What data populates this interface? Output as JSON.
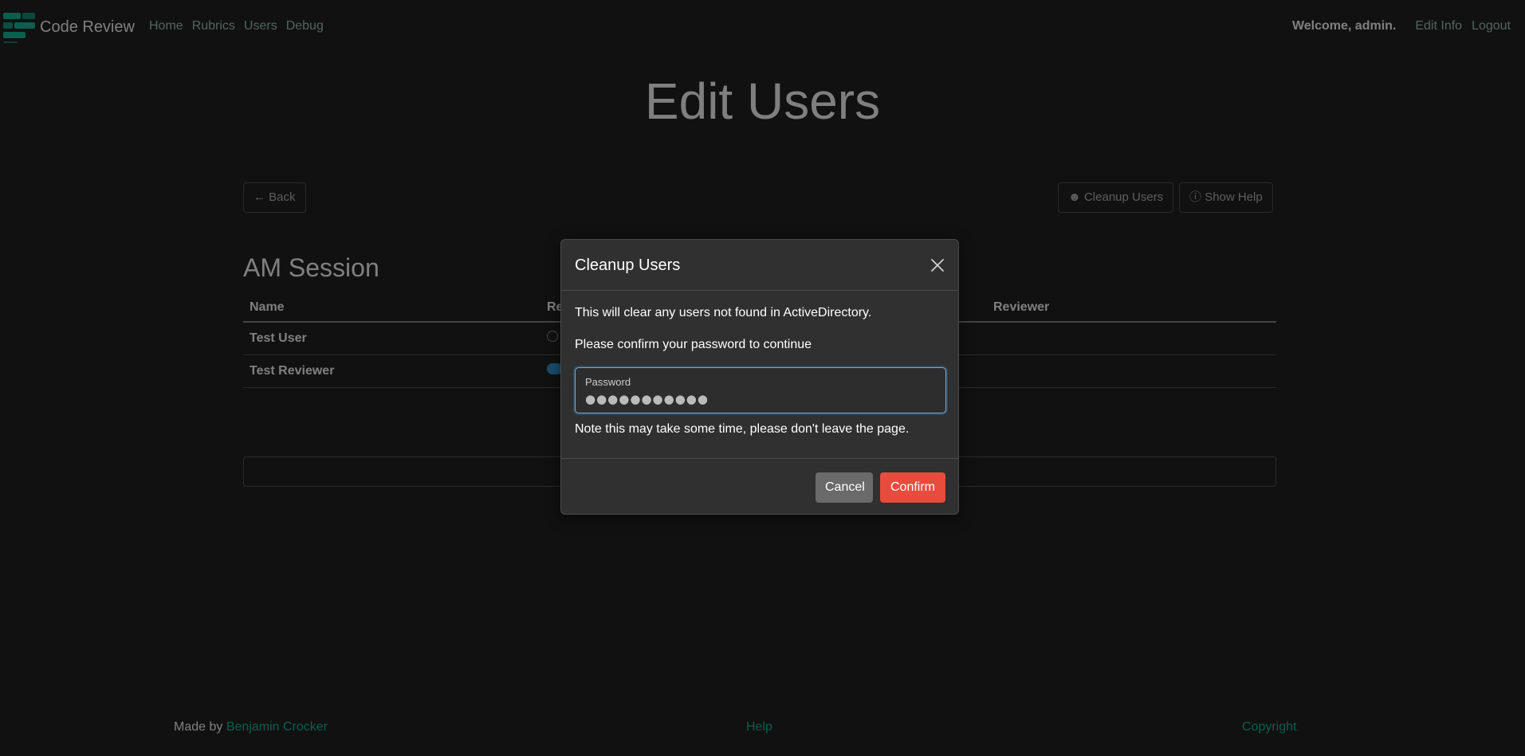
{
  "navbar": {
    "brand": "Code Review",
    "links": [
      "Home",
      "Rubrics",
      "Users",
      "Debug"
    ],
    "welcome": "Welcome, admin.",
    "edit_info": "Edit Info",
    "logout": "Logout"
  },
  "page": {
    "title": "Edit Users",
    "back_label": "← Back",
    "cleanup_label": "Cleanup Users",
    "help_label": "Show Help"
  },
  "session": {
    "title": "AM Session",
    "columns": [
      "Name",
      "Re",
      "Reviewer"
    ],
    "rows": [
      {
        "name": "Test User"
      },
      {
        "name": "Test Reviewer"
      }
    ]
  },
  "footer": {
    "made_by": "Made by",
    "author": "Benjamin Crocker",
    "help": "Help",
    "copyright": "Copyright"
  },
  "modal": {
    "title": "Cleanup Users",
    "message": "This will clear any users not found in ActiveDirectory.",
    "confirm_prompt": "Please confirm your password to continue",
    "password_label": "Password",
    "password_value": "●●●●●●●●●●●",
    "note": "Note this may take some time, please don't leave the page.",
    "cancel_label": "Cancel",
    "confirm_label": "Confirm"
  },
  "colors": {
    "accent": "#18bc9c",
    "danger": "#e74c3c",
    "secondary": "#6a6a6a",
    "info": "#3498db"
  }
}
